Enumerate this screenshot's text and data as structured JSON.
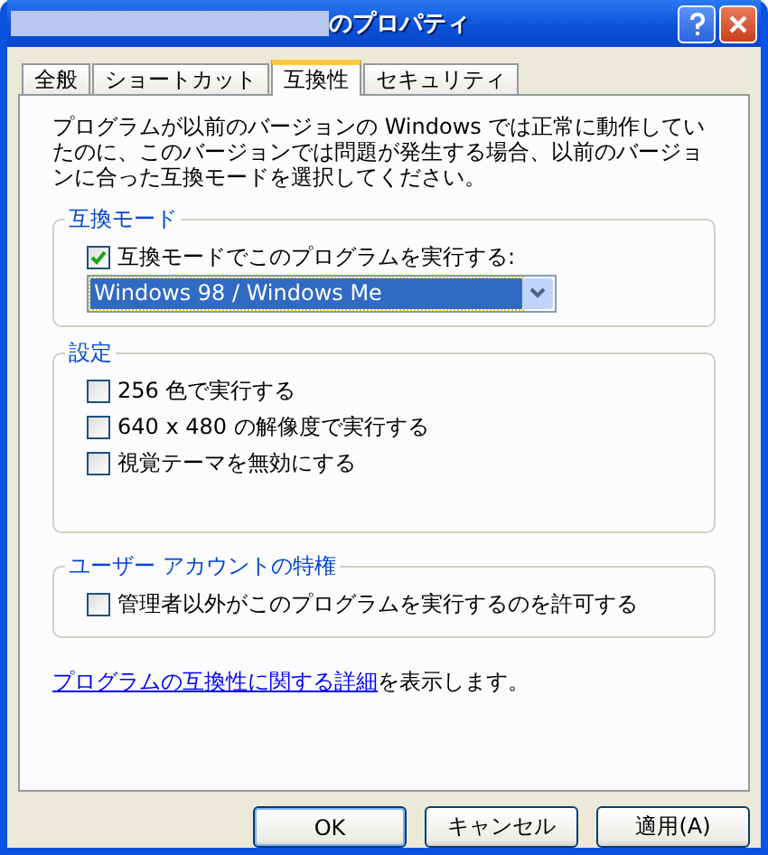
{
  "window": {
    "title": "のプロパティ"
  },
  "tabs": [
    {
      "label": "全般",
      "selected": false
    },
    {
      "label": "ショートカット",
      "selected": false
    },
    {
      "label": "互換性",
      "selected": true
    },
    {
      "label": "セキュリティ",
      "selected": false
    }
  ],
  "intro": "プログラムが以前のバージョンの Windows では正常に動作していたのに、このバージョンでは問題が発生する場合、以前のバージョンに合った互換モードを選択してください。",
  "groups": [
    {
      "title": "互換モード",
      "items": [
        {
          "kind": "checkbox",
          "label": "互換モードでこのプログラムを実行する:",
          "checked": true
        },
        {
          "kind": "dropdown",
          "value": "Windows 98 / Windows Me"
        }
      ]
    },
    {
      "title": "設定",
      "items": [
        {
          "kind": "checkbox",
          "label": "256 色で実行する",
          "checked": false
        },
        {
          "kind": "checkbox",
          "label": "640 x 480 の解像度で実行する",
          "checked": false
        },
        {
          "kind": "checkbox",
          "label": "視覚テーマを無効にする",
          "checked": false
        }
      ]
    },
    {
      "title": "ユーザー アカウントの特権",
      "items": [
        {
          "kind": "checkbox",
          "label": "管理者以外がこのプログラムを実行するのを許可する",
          "checked": false
        }
      ]
    }
  ],
  "more_info": {
    "link": "プログラムの互換性に関する詳細",
    "text": "を表示します。"
  },
  "buttons": [
    "OK",
    "キャンセル",
    "適用(A)"
  ]
}
